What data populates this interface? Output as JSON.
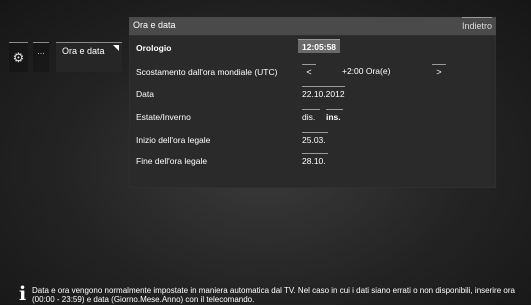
{
  "nav": {
    "settings_icon": "gear-icon",
    "dots_label": "...",
    "ora_data_label": "Ora e data"
  },
  "panel": {
    "title": "Ora e data",
    "back_label": "Indietro",
    "rows": {
      "orologio": {
        "label": "Orologio",
        "value": "12:05:58"
      },
      "scostamento": {
        "label": "Scostamento dall'ora mondiale (UTC)",
        "prev": "<",
        "value": "+2:00 Ora(e)",
        "next": ">"
      },
      "data": {
        "label": "Data",
        "value": "22.10.2012"
      },
      "estate": {
        "label": "Estate/Inverno",
        "option_a": "dis.",
        "option_b": "ins."
      },
      "inizio": {
        "label": "Inizio dell'ora legale",
        "value": "25.03."
      },
      "fine": {
        "label": "Fine dell'ora legale",
        "value": "28.10."
      }
    }
  },
  "info": {
    "icon": "info-icon",
    "text": "Data e ora vengono normalmente impostate in maniera automatica dal TV. Nel caso in cui i dati siano errati o non disponibili, inserire ora (00:00 - 23:59) e data (Giorno.Mese.Anno) con il telecomando."
  }
}
